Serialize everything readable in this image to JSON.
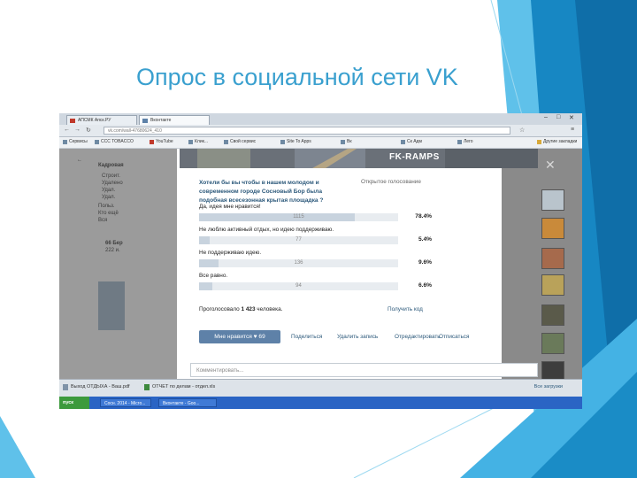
{
  "slide": {
    "title": "Опрос в социальной сети VK"
  },
  "browser": {
    "tabs": [
      "АПСМК Апск.РУ",
      "Вконтакте"
    ],
    "url": "vk.com/wall-47680624_410",
    "bookmarks": [
      "Сервисы",
      "ССС TOBACCO",
      "YouTube",
      "Клик...",
      "Свой сервис",
      "Sitе To Apps",
      "Вк",
      "Ск Адм",
      "Лего",
      "Другие закладки"
    ],
    "sidebar_texts": [
      "Кадровая",
      "Строит.",
      "Удалено",
      "Удал.",
      "Удал.",
      "Польз.",
      "Кто ещё",
      "Вся",
      "66 Бер",
      "222 и."
    ],
    "close_glyph": "✕"
  },
  "post": {
    "header_logo": "FK-RAMPS",
    "poll_question": "Хотели бы вы чтобы в нашем молодом и современном городе Сосновый Бор была подобная всесезонная крытая площадка ?",
    "poll_type": "Открытое голосование",
    "options": [
      {
        "label": "Да, идея мне нравится!",
        "count": "1115",
        "percent": "78.4%",
        "fraction": 0.784
      },
      {
        "label": "Не люблю активный отдых, но идею поддерживаю.",
        "count": "77",
        "percent": "5.4%",
        "fraction": 0.054
      },
      {
        "label": "Не поддерживаю идею.",
        "count": "136",
        "percent": "9.6%",
        "fraction": 0.096
      },
      {
        "label": "Все равно.",
        "count": "94",
        "percent": "6.6%",
        "fraction": 0.066
      }
    ],
    "voted_prefix": "Проголосовало",
    "voted_count": "1 423",
    "voted_suffix": "человека.",
    "get_code": "Получить код",
    "like_label": "Мне нравится ♥ 69",
    "actions": [
      "Поделиться",
      "Удалить запись",
      "Отредактировать",
      "Отписаться"
    ],
    "comment_placeholder": "Комментировать..."
  },
  "downloads": {
    "items": [
      "Выход ОТДЫХА - Ваш.pdf",
      "ОТЧЕТ по делам - отдел.xls"
    ],
    "show_all": "Все загрузки"
  },
  "taskbar": {
    "start": "пуск",
    "tasks": [
      "Сосн. 2014 - Micro...",
      "Вконтакте - Goo..."
    ]
  },
  "colors": {
    "title": "#3aa0cf",
    "vk_link": "#2b587a",
    "vk_button": "#5e81a8",
    "deco_dark": "#1a8cc6",
    "deco_light": "#63c5ea"
  }
}
